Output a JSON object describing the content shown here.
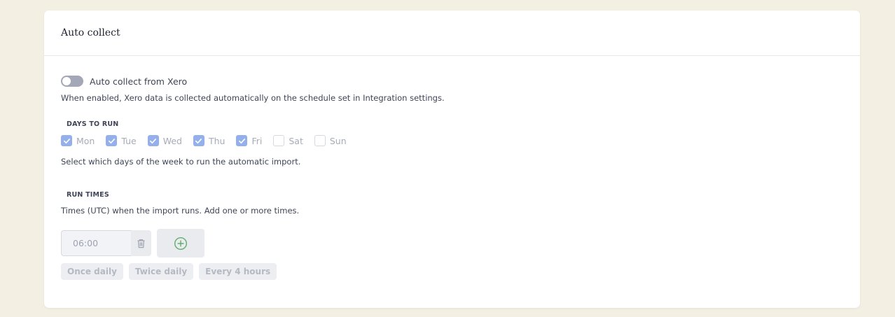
{
  "card": {
    "title": "Auto collect"
  },
  "toggle": {
    "label": "Auto collect from Xero",
    "enabled": false,
    "help": "When enabled, Xero data is collected automatically on the schedule set in Integration settings."
  },
  "days": {
    "label": "DAYS TO RUN",
    "items": [
      {
        "label": "Mon",
        "checked": true
      },
      {
        "label": "Tue",
        "checked": true
      },
      {
        "label": "Wed",
        "checked": true
      },
      {
        "label": "Thu",
        "checked": true
      },
      {
        "label": "Fri",
        "checked": true
      },
      {
        "label": "Sat",
        "checked": false
      },
      {
        "label": "Sun",
        "checked": false
      }
    ],
    "help": "Select which days of the week to run the automatic import."
  },
  "times": {
    "label": "RUN TIMES",
    "help": "Times (UTC) when the import runs. Add one or more times.",
    "values": [
      "06:00"
    ],
    "delete_icon": "trash-icon",
    "add_icon": "plus-circle-icon"
  },
  "presets": [
    "Once daily",
    "Twice daily",
    "Every 4 hours"
  ],
  "colors": {
    "background": "#f3f0e3",
    "checkbox_checked": "#94b0ec",
    "add_icon": "#5fae6a"
  }
}
